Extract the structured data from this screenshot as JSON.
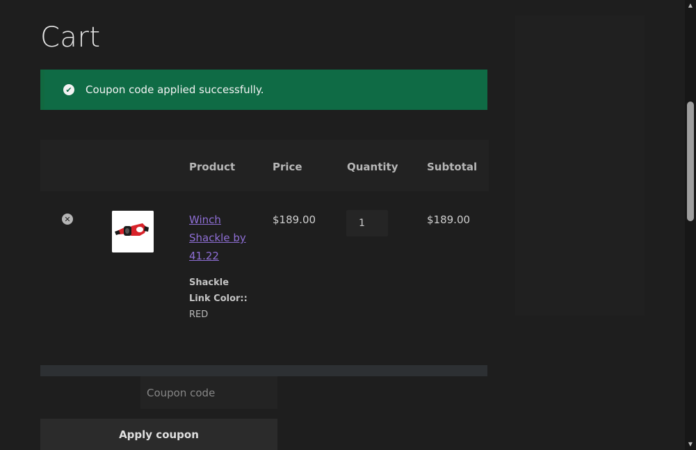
{
  "page": {
    "title": "Cart"
  },
  "notice": {
    "icon": "check-circle-icon",
    "message": "Coupon code applied successfully.",
    "color": "#0f6b45"
  },
  "cart_table": {
    "columns": [
      "Product",
      "Price",
      "Quantity",
      "Subtotal"
    ],
    "items": [
      {
        "remove_icon": "remove-circle-icon",
        "thumbnail": "winch-shackle-red-thumbnail",
        "name": "Winch Shackle by 41.22",
        "variation_label": "Shackle Link Color::",
        "variation_value": "RED",
        "price": "$189.00",
        "quantity": "1",
        "subtotal": "$189.00"
      }
    ]
  },
  "coupon": {
    "placeholder": "Coupon code",
    "value": "",
    "apply_label": "Apply coupon"
  },
  "colors": {
    "background": "#1e1e1e",
    "link": "#8f6fd6",
    "success": "#0f6b45"
  }
}
